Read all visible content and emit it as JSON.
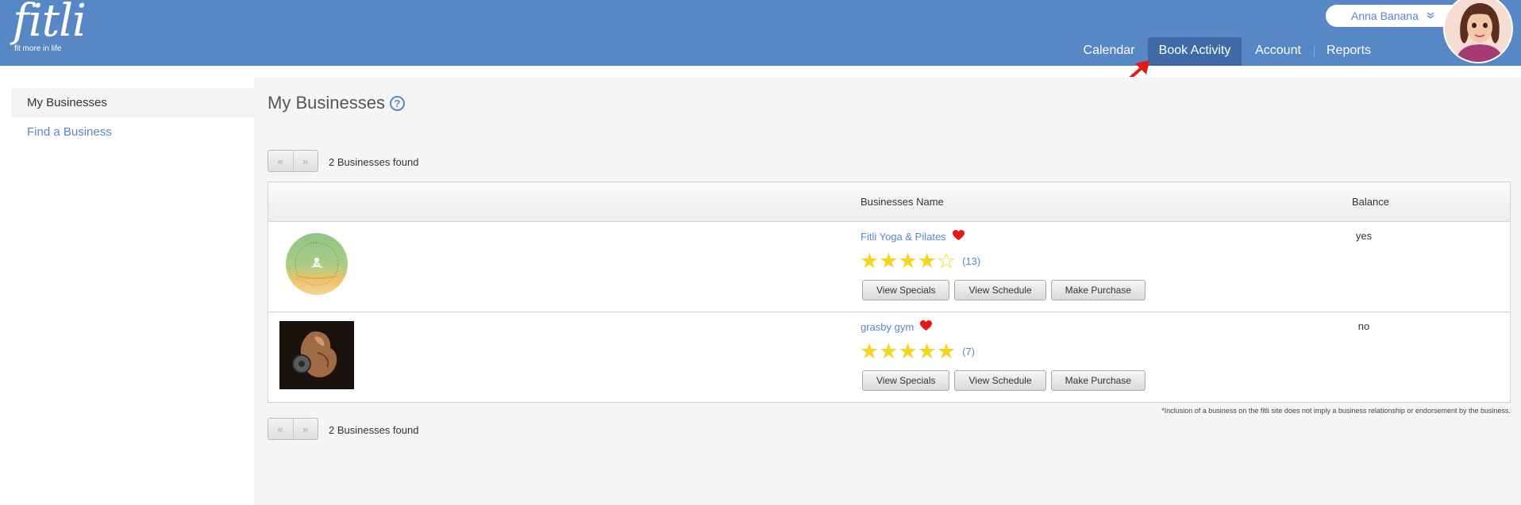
{
  "header": {
    "logo_word": "fitli",
    "logo_tagline": "fit more in life",
    "user_name": "Anna Banana",
    "nav": [
      {
        "label": "Calendar"
      },
      {
        "label": "Book Activity"
      },
      {
        "label": "Account"
      },
      {
        "label": "Reports"
      }
    ],
    "active_nav": "Book Activity"
  },
  "sidebar": {
    "items": [
      {
        "label": "My Businesses"
      },
      {
        "label": "Find a Business"
      }
    ]
  },
  "main": {
    "title": "My Businesses",
    "help_glyph": "?",
    "pager": {
      "prev": "«",
      "next": "»"
    },
    "found_text": "2 Businesses found",
    "columns": {
      "name": "Businesses Name",
      "balance": "Balance"
    },
    "businesses": [
      {
        "name": "Fitli Yoga & Pilates",
        "rating": 4,
        "reviews": "(13)",
        "balance": "yes",
        "buttons": [
          "View Specials",
          "View Schedule",
          "Make Purchase"
        ]
      },
      {
        "name": "grasby gym",
        "rating": 5,
        "reviews": "(7)",
        "balance": "no",
        "buttons": [
          "View Specials",
          "View Schedule",
          "Make Purchase"
        ]
      }
    ],
    "disclaimer": "*Inclusion of a business on the fitli site does not imply a business relationship or endorsement by the business."
  },
  "colors": {
    "header": "#5787c4",
    "active_nav": "#3f6aa5",
    "link": "#5787c4",
    "star": "#f5d51f",
    "heart": "#e31919",
    "arrow": "#e31919"
  },
  "icons": {
    "heart": "heart-icon",
    "star": "star-icon",
    "help": "help-icon",
    "user_menu": "chevron-down-icon"
  }
}
